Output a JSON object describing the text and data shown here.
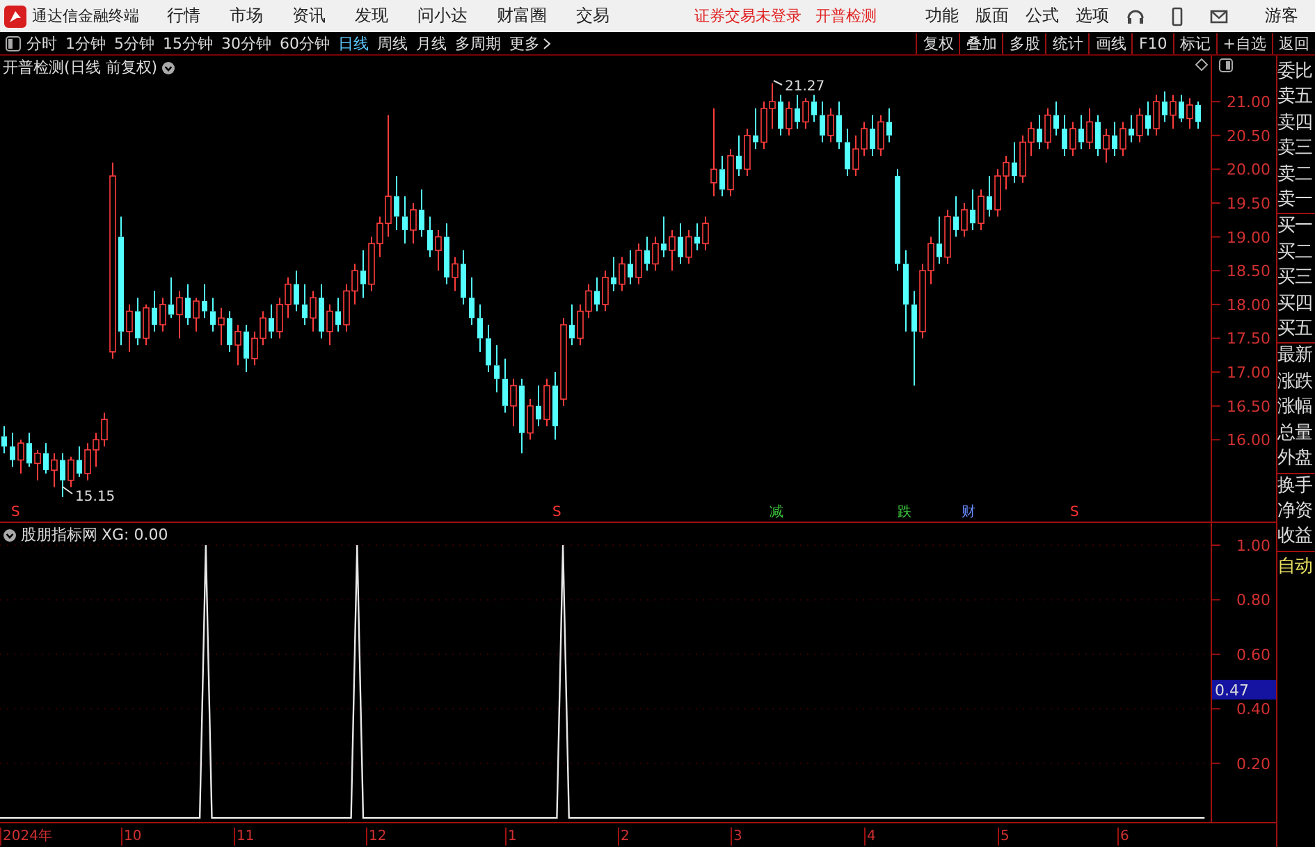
{
  "menubar": {
    "app_title": "通达信金融终端",
    "menus": [
      "行情",
      "市场",
      "资讯",
      "发现",
      "问小达",
      "财富圈",
      "交易"
    ],
    "notices": [
      "证券交易未登录",
      "开普检测"
    ],
    "tools": [
      "功能",
      "版面",
      "公式",
      "选项"
    ],
    "user": "游客"
  },
  "toolbar": {
    "periods": [
      {
        "label": "分时",
        "selected": false
      },
      {
        "label": "1分钟",
        "selected": false
      },
      {
        "label": "5分钟",
        "selected": false
      },
      {
        "label": "15分钟",
        "selected": false
      },
      {
        "label": "30分钟",
        "selected": false
      },
      {
        "label": "60分钟",
        "selected": false
      },
      {
        "label": "日线",
        "selected": true
      },
      {
        "label": "周线",
        "selected": false
      },
      {
        "label": "月线",
        "selected": false
      },
      {
        "label": "多周期",
        "selected": false
      }
    ],
    "more": "更多",
    "actions": [
      "复权",
      "叠加",
      "多股",
      "统计",
      "画线",
      "F10",
      "标记",
      "+自选",
      "返回"
    ]
  },
  "main_chart": {
    "title": "开普检测(日线 前复权)",
    "high_label": "21.27",
    "low_label": "15.15",
    "markers": [
      {
        "label": "S",
        "color": "#ff3232"
      },
      {
        "label": "S",
        "color": "#ff3232"
      },
      {
        "label": "减",
        "color": "#3cc83c"
      },
      {
        "label": "跌",
        "color": "#3cc83c"
      },
      {
        "label": "财",
        "color": "#6a8cff"
      },
      {
        "label": "S",
        "color": "#ff3232"
      }
    ],
    "chart_data": {
      "type": "candlestick",
      "ylim": [
        14.79,
        21.68
      ],
      "yticks": [
        {
          "value": 21,
          "label": "21.00"
        },
        {
          "value": 20.5,
          "label": "20.50"
        },
        {
          "value": 20,
          "label": "20.00"
        },
        {
          "value": 19.5,
          "label": "19.50"
        },
        {
          "value": 19,
          "label": "19.00"
        },
        {
          "value": 18.5,
          "label": "18.50"
        },
        {
          "value": 18,
          "label": "18.00"
        },
        {
          "value": 17.5,
          "label": "17.50"
        },
        {
          "value": 17,
          "label": "17.00"
        },
        {
          "value": 16.5,
          "label": "16.50"
        },
        {
          "value": 16,
          "label": "16.00"
        }
      ],
      "ohlc": [
        [
          16.05,
          16.2,
          15.8,
          15.9
        ],
        [
          15.9,
          16.1,
          15.6,
          15.7
        ],
        [
          15.7,
          16.0,
          15.5,
          15.95
        ],
        [
          15.95,
          16.1,
          15.6,
          15.65
        ],
        [
          15.65,
          15.85,
          15.4,
          15.8
        ],
        [
          15.8,
          15.95,
          15.5,
          15.55
        ],
        [
          15.55,
          15.8,
          15.3,
          15.7
        ],
        [
          15.7,
          15.8,
          15.15,
          15.4
        ],
        [
          15.4,
          15.75,
          15.3,
          15.7
        ],
        [
          15.7,
          15.9,
          15.45,
          15.5
        ],
        [
          15.5,
          15.95,
          15.4,
          15.85
        ],
        [
          15.85,
          16.1,
          15.6,
          16.0
        ],
        [
          16.0,
          16.4,
          15.9,
          16.3
        ],
        [
          17.3,
          20.1,
          17.2,
          19.9
        ],
        [
          19.0,
          19.3,
          17.4,
          17.6
        ],
        [
          17.6,
          18.0,
          17.3,
          17.9
        ],
        [
          17.9,
          18.1,
          17.4,
          17.5
        ],
        [
          17.5,
          18.0,
          17.4,
          17.95
        ],
        [
          17.95,
          18.2,
          17.6,
          17.7
        ],
        [
          17.7,
          18.1,
          17.6,
          18.0
        ],
        [
          18.0,
          18.4,
          17.8,
          17.85
        ],
        [
          17.85,
          18.2,
          17.5,
          18.1
        ],
        [
          18.1,
          18.3,
          17.7,
          17.8
        ],
        [
          17.8,
          18.1,
          17.6,
          18.05
        ],
        [
          18.05,
          18.3,
          17.8,
          17.9
        ],
        [
          17.9,
          18.1,
          17.6,
          17.7
        ],
        [
          17.7,
          17.95,
          17.4,
          17.8
        ],
        [
          17.8,
          17.9,
          17.3,
          17.4
        ],
        [
          17.4,
          17.7,
          17.1,
          17.6
        ],
        [
          17.6,
          17.7,
          17.0,
          17.2
        ],
        [
          17.2,
          17.6,
          17.1,
          17.5
        ],
        [
          17.5,
          17.9,
          17.4,
          17.8
        ],
        [
          17.8,
          18.0,
          17.5,
          17.6
        ],
        [
          17.6,
          18.1,
          17.5,
          18.0
        ],
        [
          18.0,
          18.4,
          17.8,
          18.3
        ],
        [
          18.3,
          18.5,
          17.9,
          18.0
        ],
        [
          18.0,
          18.3,
          17.7,
          17.8
        ],
        [
          17.8,
          18.2,
          17.6,
          18.1
        ],
        [
          18.1,
          18.3,
          17.5,
          17.6
        ],
        [
          17.6,
          18.0,
          17.4,
          17.9
        ],
        [
          17.9,
          18.1,
          17.6,
          17.7
        ],
        [
          17.7,
          18.3,
          17.6,
          18.2
        ],
        [
          18.2,
          18.6,
          18.0,
          18.5
        ],
        [
          18.5,
          18.8,
          18.1,
          18.3
        ],
        [
          18.3,
          19.0,
          18.2,
          18.9
        ],
        [
          18.9,
          19.3,
          18.7,
          19.2
        ],
        [
          19.2,
          20.8,
          19.0,
          19.6
        ],
        [
          19.6,
          19.9,
          19.1,
          19.3
        ],
        [
          19.3,
          19.6,
          18.9,
          19.1
        ],
        [
          19.1,
          19.5,
          18.9,
          19.4
        ],
        [
          19.4,
          19.7,
          19.0,
          19.1
        ],
        [
          19.1,
          19.3,
          18.7,
          18.8
        ],
        [
          18.8,
          19.1,
          18.5,
          19.0
        ],
        [
          19.0,
          19.2,
          18.3,
          18.4
        ],
        [
          18.4,
          18.7,
          18.2,
          18.6
        ],
        [
          18.6,
          18.8,
          18.0,
          18.1
        ],
        [
          18.1,
          18.4,
          17.7,
          17.8
        ],
        [
          17.8,
          18.0,
          17.3,
          17.5
        ],
        [
          17.5,
          17.7,
          17.0,
          17.1
        ],
        [
          17.1,
          17.4,
          16.7,
          16.9
        ],
        [
          16.9,
          17.2,
          16.4,
          16.5
        ],
        [
          16.5,
          16.9,
          16.2,
          16.8
        ],
        [
          16.8,
          16.9,
          15.8,
          16.1
        ],
        [
          16.1,
          16.6,
          16.0,
          16.5
        ],
        [
          16.5,
          16.8,
          16.2,
          16.3
        ],
        [
          16.3,
          16.9,
          16.2,
          16.8
        ],
        [
          16.8,
          17.0,
          16.0,
          16.2
        ],
        [
          16.6,
          17.8,
          16.5,
          17.7
        ],
        [
          17.7,
          18.0,
          17.4,
          17.5
        ],
        [
          17.5,
          18.0,
          17.4,
          17.9
        ],
        [
          17.9,
          18.3,
          17.8,
          18.2
        ],
        [
          18.2,
          18.4,
          17.9,
          18.0
        ],
        [
          18.0,
          18.5,
          17.9,
          18.4
        ],
        [
          18.4,
          18.7,
          18.2,
          18.3
        ],
        [
          18.3,
          18.7,
          18.2,
          18.6
        ],
        [
          18.6,
          18.8,
          18.3,
          18.4
        ],
        [
          18.4,
          18.9,
          18.3,
          18.8
        ],
        [
          18.8,
          19.0,
          18.5,
          18.6
        ],
        [
          18.6,
          19.0,
          18.5,
          18.9
        ],
        [
          18.9,
          19.3,
          18.7,
          18.8
        ],
        [
          18.8,
          19.1,
          18.5,
          19.0
        ],
        [
          19.0,
          19.2,
          18.6,
          18.7
        ],
        [
          18.7,
          19.1,
          18.6,
          19.0
        ],
        [
          19.0,
          19.2,
          18.8,
          18.9
        ],
        [
          18.9,
          19.3,
          18.8,
          19.2
        ],
        [
          19.8,
          20.9,
          19.6,
          20.0
        ],
        [
          20.0,
          20.2,
          19.6,
          19.7
        ],
        [
          19.7,
          20.3,
          19.6,
          20.2
        ],
        [
          20.2,
          20.5,
          19.9,
          20.0
        ],
        [
          20.0,
          20.6,
          19.9,
          20.5
        ],
        [
          20.5,
          20.9,
          20.3,
          20.4
        ],
        [
          20.4,
          21.0,
          20.3,
          20.9
        ],
        [
          20.9,
          21.27,
          20.6,
          21.0
        ],
        [
          21.0,
          21.1,
          20.5,
          20.6
        ],
        [
          20.6,
          21.0,
          20.5,
          20.9
        ],
        [
          20.9,
          21.1,
          20.6,
          20.7
        ],
        [
          20.7,
          21.05,
          20.6,
          21.0
        ],
        [
          21.0,
          21.1,
          20.7,
          20.8
        ],
        [
          20.8,
          21.0,
          20.4,
          20.5
        ],
        [
          20.5,
          20.9,
          20.4,
          20.8
        ],
        [
          20.8,
          21.0,
          20.3,
          20.4
        ],
        [
          20.4,
          20.6,
          19.9,
          20.0
        ],
        [
          20.0,
          20.5,
          19.9,
          20.3
        ],
        [
          20.3,
          20.7,
          20.2,
          20.6
        ],
        [
          20.6,
          20.8,
          20.2,
          20.3
        ],
        [
          20.3,
          20.8,
          20.2,
          20.7
        ],
        [
          20.7,
          20.9,
          20.4,
          20.5
        ],
        [
          19.9,
          20.0,
          18.5,
          18.6
        ],
        [
          18.6,
          18.8,
          17.6,
          18.0
        ],
        [
          18.0,
          18.2,
          16.8,
          17.6
        ],
        [
          17.6,
          18.6,
          17.5,
          18.5
        ],
        [
          18.5,
          19.0,
          18.3,
          18.9
        ],
        [
          18.9,
          19.3,
          18.6,
          18.7
        ],
        [
          18.7,
          19.4,
          18.6,
          19.3
        ],
        [
          19.3,
          19.6,
          19.0,
          19.1
        ],
        [
          19.1,
          19.5,
          19.0,
          19.4
        ],
        [
          19.4,
          19.7,
          19.1,
          19.2
        ],
        [
          19.2,
          19.7,
          19.1,
          19.6
        ],
        [
          19.6,
          19.9,
          19.3,
          19.4
        ],
        [
          19.4,
          20.0,
          19.3,
          19.9
        ],
        [
          19.9,
          20.2,
          19.7,
          20.1
        ],
        [
          20.1,
          20.4,
          19.8,
          19.9
        ],
        [
          19.9,
          20.5,
          19.8,
          20.4
        ],
        [
          20.4,
          20.7,
          20.2,
          20.6
        ],
        [
          20.6,
          20.8,
          20.3,
          20.4
        ],
        [
          20.4,
          20.9,
          20.3,
          20.8
        ],
        [
          20.8,
          21.0,
          20.5,
          20.6
        ],
        [
          20.6,
          20.8,
          20.2,
          20.3
        ],
        [
          20.3,
          20.7,
          20.2,
          20.6
        ],
        [
          20.6,
          20.8,
          20.3,
          20.4
        ],
        [
          20.4,
          20.9,
          20.3,
          20.7
        ],
        [
          20.7,
          20.8,
          20.2,
          20.3
        ],
        [
          20.3,
          20.6,
          20.1,
          20.5
        ],
        [
          20.5,
          20.7,
          20.2,
          20.3
        ],
        [
          20.3,
          20.7,
          20.2,
          20.6
        ],
        [
          20.6,
          20.8,
          20.4,
          20.5
        ],
        [
          20.5,
          20.9,
          20.4,
          20.8
        ],
        [
          20.8,
          21.0,
          20.5,
          20.6
        ],
        [
          20.6,
          21.1,
          20.5,
          21.0
        ],
        [
          21.0,
          21.15,
          20.7,
          20.8
        ],
        [
          20.8,
          21.1,
          20.6,
          21.0
        ],
        [
          21.0,
          21.1,
          20.7,
          20.75
        ],
        [
          20.75,
          21.05,
          20.6,
          20.95
        ],
        [
          20.95,
          21.0,
          20.6,
          20.7
        ]
      ]
    }
  },
  "indicator": {
    "title": "股朋指标网",
    "reading": "XG: 0.00",
    "current_value": "0.47",
    "chart_data": {
      "type": "line",
      "grid": true,
      "ylim": [
        -0.015,
        1
      ],
      "yticks": [
        {
          "value": 1,
          "label": "1.00"
        },
        {
          "value": 0.8,
          "label": "0.80"
        },
        {
          "value": 0.6,
          "label": "0.60"
        },
        {
          "value": 0.4,
          "label": "0.40"
        },
        {
          "value": 0.2,
          "label": "0.20"
        }
      ],
      "series": [
        {
          "color": "#e8e8e8",
          "values": [
            0,
            0,
            0,
            0,
            0,
            0,
            0,
            0,
            0,
            0,
            0,
            0,
            0,
            0,
            0,
            0,
            0,
            0,
            0,
            0,
            0,
            0,
            0,
            0,
            0,
            0,
            0,
            0,
            0,
            0,
            0,
            0,
            0,
            0,
            1,
            0,
            0,
            0,
            0,
            0,
            0,
            0,
            0,
            0,
            0,
            0,
            0,
            0,
            0,
            0,
            0,
            0,
            0,
            0,
            0,
            0,
            0,
            0,
            0,
            1,
            0,
            0,
            0,
            0,
            0,
            0,
            0,
            0,
            0,
            0,
            0,
            0,
            0,
            0,
            0,
            0,
            0,
            0,
            0,
            0,
            0,
            0,
            0,
            0,
            0,
            0,
            0,
            0,
            0,
            0,
            0,
            0,
            0,
            1,
            0,
            0,
            0,
            0,
            0,
            0,
            0,
            0,
            0,
            0,
            0,
            0,
            0,
            0,
            0,
            0,
            0,
            0,
            0,
            0,
            0,
            0,
            0,
            0,
            0,
            0,
            0,
            0,
            0,
            0,
            0,
            0,
            0,
            0,
            0,
            0,
            0,
            0,
            0,
            0,
            0,
            0,
            0,
            0,
            0,
            0,
            0,
            0,
            0,
            0,
            0,
            0,
            0,
            0,
            0,
            0,
            0,
            0,
            0,
            0,
            0,
            0,
            0,
            0,
            0,
            0,
            0,
            0,
            0,
            0,
            0,
            0,
            0,
            0,
            0,
            0,
            0,
            0,
            0,
            0,
            0,
            0,
            0,
            0,
            0,
            0,
            0,
            0,
            0,
            0,
            0,
            0,
            0,
            0,
            0,
            0,
            0,
            0,
            0,
            0,
            0,
            0,
            0,
            0,
            0,
            0
          ]
        }
      ]
    }
  },
  "date_axis": [
    "2024年",
    "10",
    "11",
    "12",
    "1",
    "2",
    "3",
    "4",
    "5",
    "6"
  ],
  "sidebar": {
    "groups": [
      [
        "委比",
        "卖五",
        "卖四",
        "卖三",
        "卖二",
        "卖一"
      ],
      [
        "买一",
        "买二",
        "买三",
        "买四",
        "买五"
      ],
      [
        "最新",
        "涨跌",
        "涨幅",
        "总量",
        "外盘"
      ],
      [
        "换手",
        "净资",
        "收益"
      ]
    ],
    "auto_button": "自动"
  }
}
